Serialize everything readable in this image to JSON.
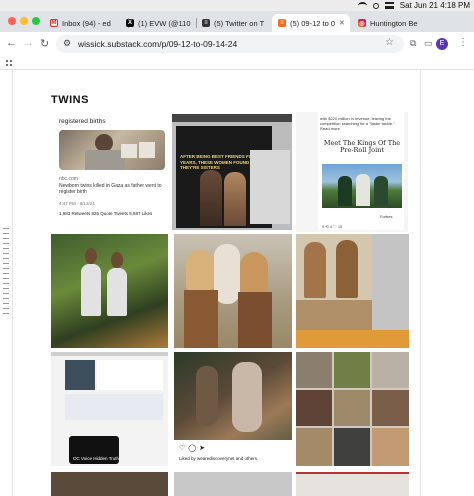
{
  "menubar": {
    "datetime": "Sat Jun 21  4:18 PM"
  },
  "tabs": [
    {
      "label": "Inbox (94) - ed",
      "favicon": "gmail-icon",
      "color": "#d93025",
      "glyph": "M"
    },
    {
      "label": "(1) EVW (@110",
      "favicon": "x-icon",
      "color": "#000000",
      "glyph": "X"
    },
    {
      "label": "(5) Twitter on T",
      "favicon": "substack-icon",
      "color": "#333333",
      "glyph": "≡"
    },
    {
      "label": "(5) 09-12 to 0",
      "favicon": "substack-orange-icon",
      "color": "#ff6719",
      "glyph": "≡"
    },
    {
      "label": "Huntington Be",
      "favicon": "instagram-icon",
      "color": "#d6249f",
      "glyph": "◎"
    }
  ],
  "address": {
    "url": "wissick.substack.com/p/09-12-to-09-14-24"
  },
  "profile": {
    "initial": "E"
  },
  "post": {
    "heading": "TWINS",
    "tweet": {
      "header": "registered births",
      "source": "nbc.com",
      "caption": "Newborn twins killed in Gaza as father went to register birth",
      "meta": "4:47 PM · 8/13/24",
      "stats": "1,983 Retweets  826 Quote Tweets  5,587 Likes"
    },
    "phone_caption": "AFTER BEING BEST FRIENDS FOR 17 YEARS, THESE WOMEN FOUND OUT THEY'RE SISTERS",
    "kings": {
      "intro": "with $220 million in revenue, leaving the competition searching for a \"faster tackle.\" Read more",
      "title": "Meet The Kings Of The Pre-Roll Joint",
      "footer": "Forbes",
      "counts": "9  ⟲ 4  ♡ 15"
    },
    "instagram": {
      "liked": "Liked by wearediscoverynet and others"
    },
    "podcast": {
      "text": "OC Voice Hidden Truth"
    }
  }
}
